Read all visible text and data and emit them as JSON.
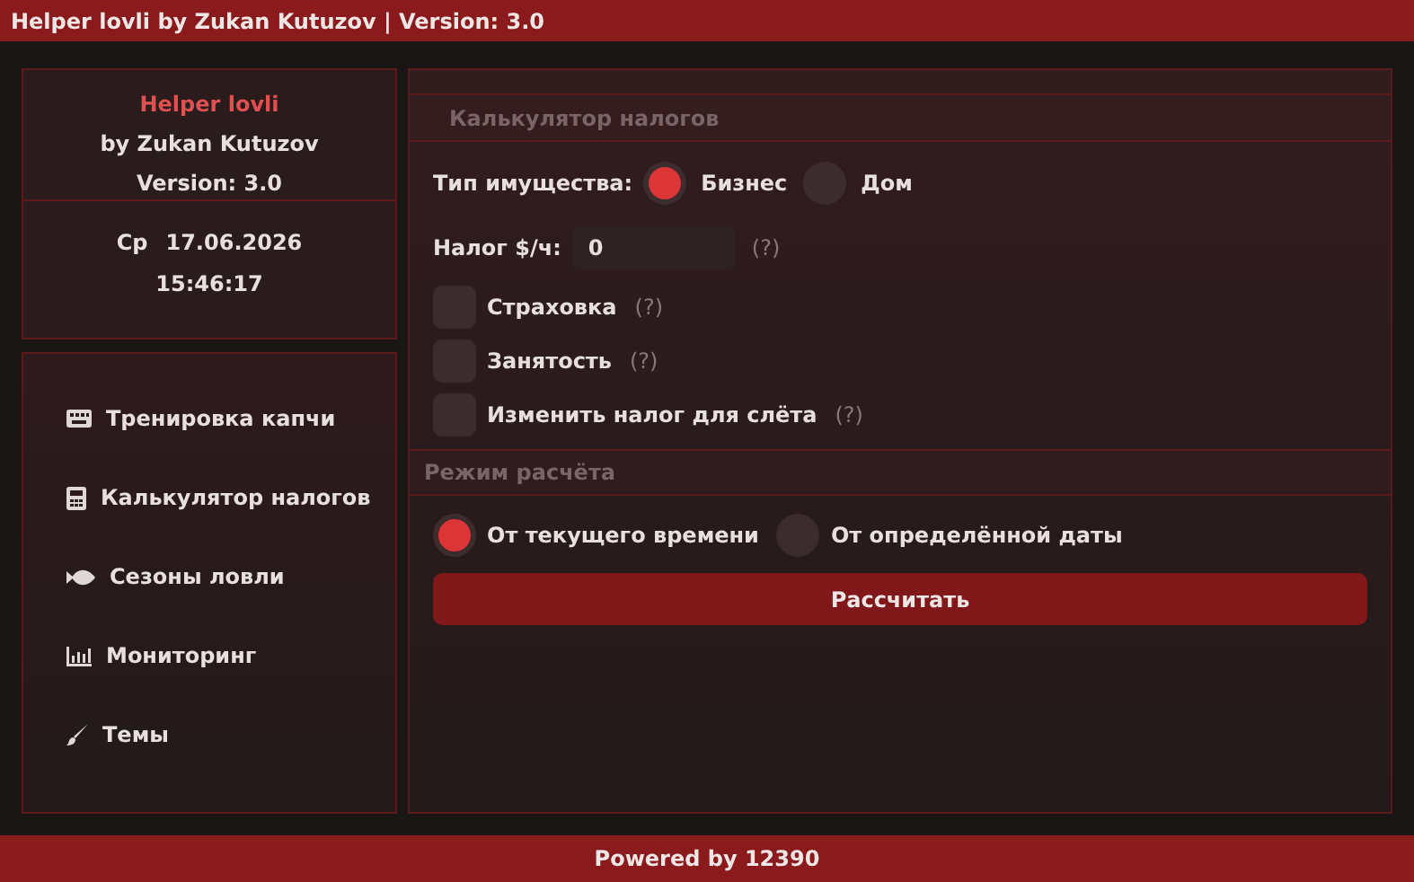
{
  "window": {
    "title": "Helper lovli by Zukan Kutuzov | Version: 3.0"
  },
  "info": {
    "app_name": "Helper lovli",
    "author": "by Zukan Kutuzov",
    "version": "Version: 3.0",
    "day": "Ср",
    "date": "17.06.2026",
    "time": "15:46:17"
  },
  "sidebar": {
    "items": [
      {
        "label": "Тренировка капчи"
      },
      {
        "label": "Калькулятор налогов"
      },
      {
        "label": "Сезоны ловли"
      },
      {
        "label": "Мониторинг"
      },
      {
        "label": "Темы"
      }
    ]
  },
  "calculator": {
    "section_title": "Калькулятор налогов",
    "property_type": {
      "label": "Тип имущества:",
      "options": [
        {
          "label": "Бизнес",
          "selected": true
        },
        {
          "label": "Дом",
          "selected": false
        }
      ]
    },
    "tax": {
      "label": "Налог $/ч:",
      "value": "0",
      "help": "(?)"
    },
    "checkboxes": [
      {
        "label": "Страховка",
        "help": "(?)",
        "checked": false
      },
      {
        "label": "Занятость",
        "help": "(?)",
        "checked": false
      },
      {
        "label": "Изменить налог для слёта",
        "help": "(?)",
        "checked": false
      }
    ],
    "mode_title": "Режим расчёта",
    "modes": [
      {
        "label": "От текущего времени",
        "selected": true
      },
      {
        "label": "От определённой даты",
        "selected": false
      }
    ],
    "button": "Рассчитать"
  },
  "status_bar": {
    "text": "Powered by 12390"
  }
}
